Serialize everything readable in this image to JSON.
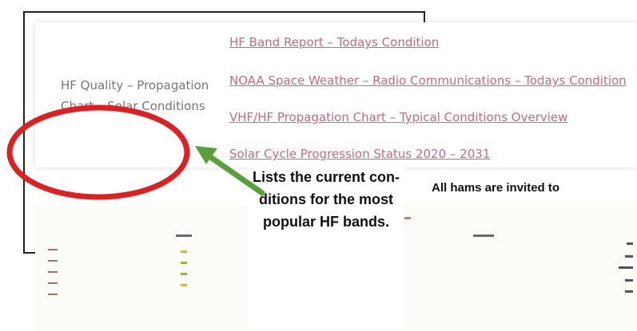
{
  "sidebar": {
    "label": "HF Quality – Propagation Chart – Solar Conditions"
  },
  "links": [
    {
      "label": "HF Band Report – Todays Condition"
    },
    {
      "label": "NOAA Space Weather – Radio Communications – Todays Condition"
    },
    {
      "label": "VHF/HF Propagation Chart – Typical Conditions Overview"
    },
    {
      "label": "Solar Cycle Progression Status 2020 – 2031"
    }
  ],
  "callout": {
    "text": "Lists the current con-ditions for the most popular HF bands."
  },
  "side_text": "All hams are invited to",
  "colors": {
    "link": "#c86a7a",
    "circle": "#e02020",
    "arrow": "#5aa03a"
  }
}
